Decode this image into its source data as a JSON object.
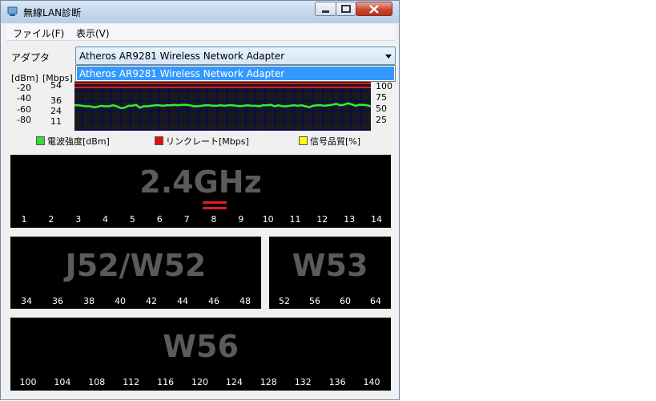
{
  "window": {
    "title": "無線LAN診断",
    "controls": {
      "minimize": "minimize",
      "maximize": "maximize",
      "close": "close"
    }
  },
  "menu": {
    "file": "ファイル(F)",
    "view": "表示(V)"
  },
  "adapter": {
    "label": "アダプタ",
    "selected": "Atheros AR9281 Wireless Network Adapter",
    "options": [
      "Atheros AR9281 Wireless Network Adapter"
    ]
  },
  "graph": {
    "left_headers": {
      "dbm": "[dBm]",
      "mbps": "[Mbps]"
    },
    "dbm_ticks": [
      "-20",
      "-40",
      "-60",
      "-80"
    ],
    "mbps_ticks": [
      "54",
      "36",
      "24",
      "11"
    ],
    "pct_ticks": [
      "100",
      "75",
      "50",
      "25"
    ],
    "signal_series": [
      52,
      52,
      51,
      50,
      50,
      48,
      49,
      51,
      50,
      50,
      52,
      50,
      46,
      47,
      51,
      51,
      53,
      47,
      50,
      50,
      51,
      52,
      52,
      51,
      52,
      52,
      53,
      52,
      53,
      53,
      52,
      50,
      50,
      51,
      52,
      52,
      51,
      51,
      52,
      51,
      52,
      52,
      51,
      50,
      51,
      52,
      51,
      51,
      50,
      52,
      52,
      53,
      50,
      52,
      50,
      50,
      51,
      52,
      51,
      52,
      50,
      48,
      51,
      52,
      52,
      51,
      52,
      53,
      55,
      52,
      53,
      56,
      54,
      51,
      53,
      53,
      52,
      50
    ],
    "colors": {
      "background": "#1a1a1a",
      "grid": "#000080",
      "signal": "#33ee33",
      "link": "#e01c1c",
      "quality": "#ffff00"
    }
  },
  "legend": [
    {
      "label": "電波強度[dBm]",
      "color": "#33dd33"
    },
    {
      "label": "リンクレート[Mbps]",
      "color": "#dd1111"
    },
    {
      "label": "信号品質[%]",
      "color": "#ffff00"
    }
  ],
  "bands": {
    "b24": {
      "name": "2.4GHz",
      "channels": [
        "1",
        "2",
        "3",
        "4",
        "5",
        "6",
        "7",
        "8",
        "9",
        "10",
        "11",
        "12",
        "13",
        "14"
      ],
      "active_channel": "8"
    },
    "w52": {
      "name": "J52/W52",
      "channels": [
        "34",
        "36",
        "38",
        "40",
        "42",
        "44",
        "46",
        "48"
      ]
    },
    "w53": {
      "name": "W53",
      "channels": [
        "52",
        "56",
        "60",
        "64"
      ]
    },
    "w56": {
      "name": "W56",
      "channels": [
        "100",
        "104",
        "108",
        "112",
        "116",
        "120",
        "124",
        "128",
        "132",
        "136",
        "140"
      ]
    }
  }
}
